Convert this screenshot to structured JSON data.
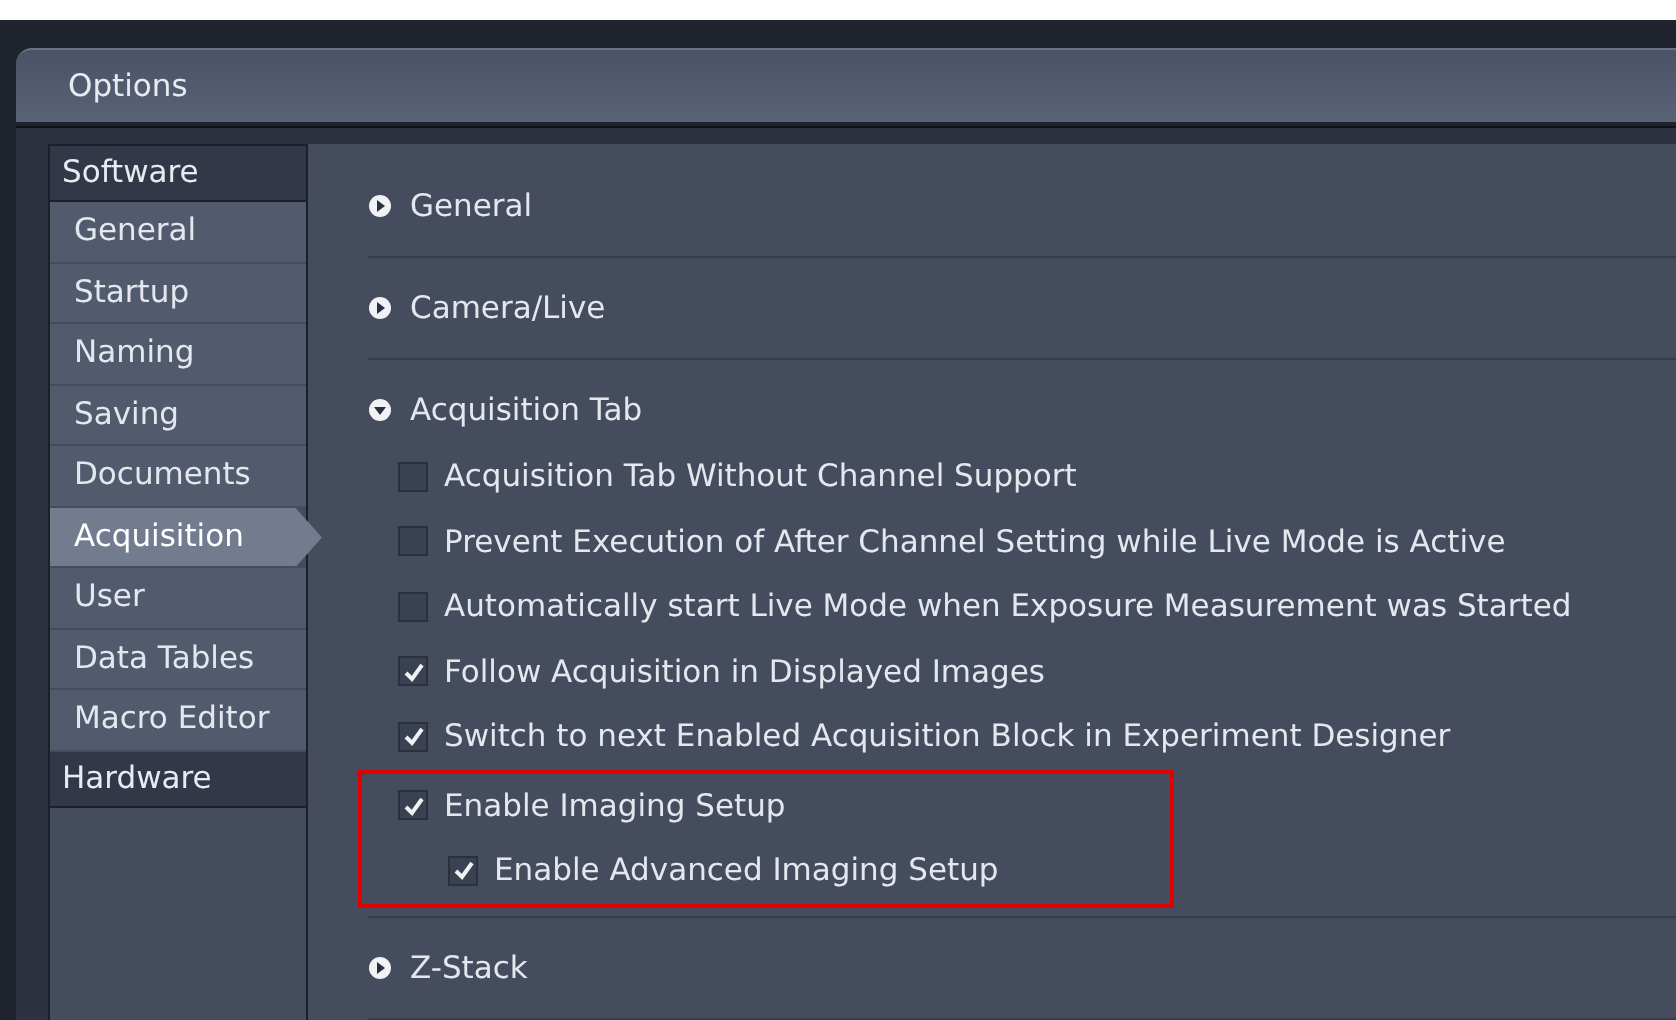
{
  "window": {
    "title": "Options"
  },
  "sidebar": {
    "groups": [
      {
        "label": "Software",
        "items": [
          {
            "label": "General",
            "selected": false
          },
          {
            "label": "Startup",
            "selected": false
          },
          {
            "label": "Naming",
            "selected": false
          },
          {
            "label": "Saving",
            "selected": false
          },
          {
            "label": "Documents",
            "selected": false
          },
          {
            "label": "Acquisition",
            "selected": true
          },
          {
            "label": "User",
            "selected": false
          },
          {
            "label": "Data Tables",
            "selected": false
          },
          {
            "label": "Macro Editor",
            "selected": false
          }
        ]
      },
      {
        "label": "Hardware"
      }
    ]
  },
  "sections": [
    {
      "title": "General",
      "expanded": false
    },
    {
      "title": "Camera/Live",
      "expanded": false
    },
    {
      "title": "Acquisition Tab",
      "expanded": true,
      "options": [
        {
          "label": "Acquisition Tab Without Channel Support",
          "checked": false
        },
        {
          "label": "Prevent Execution of After Channel Setting while Live Mode is Active",
          "checked": false
        },
        {
          "label": "Automatically start Live Mode when Exposure Measurement was Started",
          "checked": false
        },
        {
          "label": "Follow Acquisition in Displayed Images",
          "checked": true
        },
        {
          "label": "Switch to next Enabled Acquisition Block in Experiment Designer",
          "checked": true
        },
        {
          "label": "Enable Imaging Setup",
          "checked": true,
          "highlighted": true,
          "children": [
            {
              "label": "Enable Advanced Imaging Setup",
              "checked": true
            }
          ]
        }
      ]
    },
    {
      "title": "Z-Stack",
      "expanded": false
    }
  ]
}
